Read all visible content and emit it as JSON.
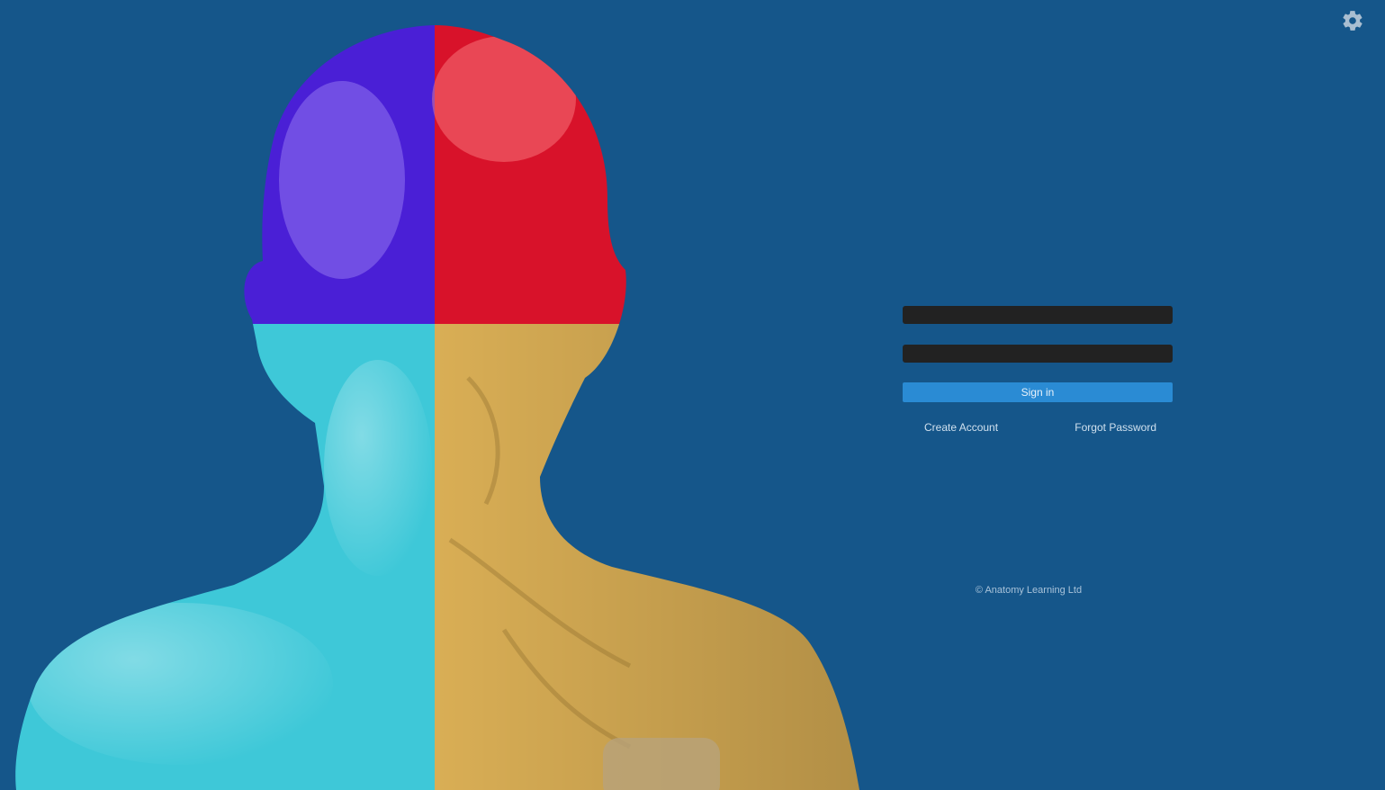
{
  "login": {
    "username_placeholder": "",
    "password_placeholder": "",
    "signin_label": "Sign in",
    "create_account_label": "Create Account",
    "forgot_password_label": "Forgot Password"
  },
  "footer": {
    "copyright": "© Anatomy Learning Ltd"
  },
  "colors": {
    "background": "#15568a",
    "quadrant_top_left": "#4a1fd6",
    "quadrant_top_right": "#d8122a",
    "quadrant_bottom_left": "#3ec8d8",
    "quadrant_bottom_right": "#d9ae55",
    "signin_button": "#2a8bd4",
    "input_fill": "#222222"
  },
  "icons": {
    "settings": "gear-icon"
  }
}
